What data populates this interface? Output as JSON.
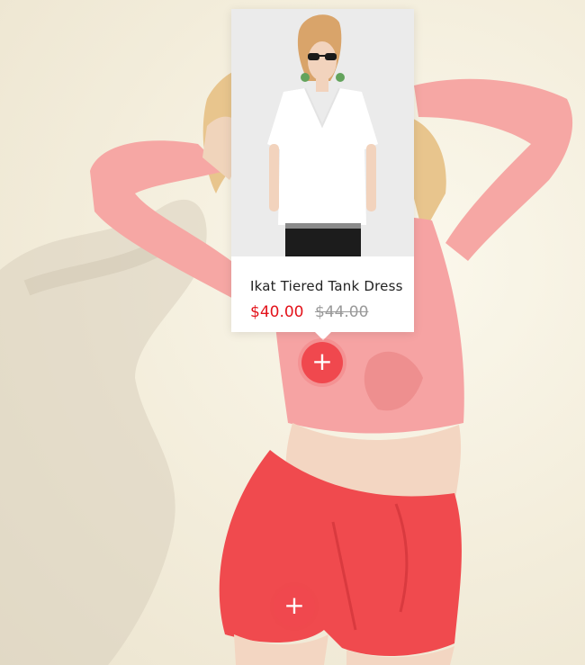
{
  "lookbook": {
    "image_alt_icon": "model-photo",
    "popup": {
      "product_name": "Ikat Tiered Tank Dress",
      "price_current": "$40.00",
      "price_original": "$44.00",
      "image_icon": "white-tshirt-product-photo"
    },
    "hotspots": [
      {
        "label": "+",
        "icon": "plus-icon",
        "state": "active"
      },
      {
        "label": "+",
        "icon": "plus-icon",
        "state": "inactive"
      }
    ]
  },
  "colors": {
    "accent": "#f0484e",
    "price_current": "#e3131b",
    "price_original": "#9a9a9a",
    "shirt": "#f6a3a3",
    "shorts": "#f04a4e",
    "background": "#f3eee0"
  }
}
